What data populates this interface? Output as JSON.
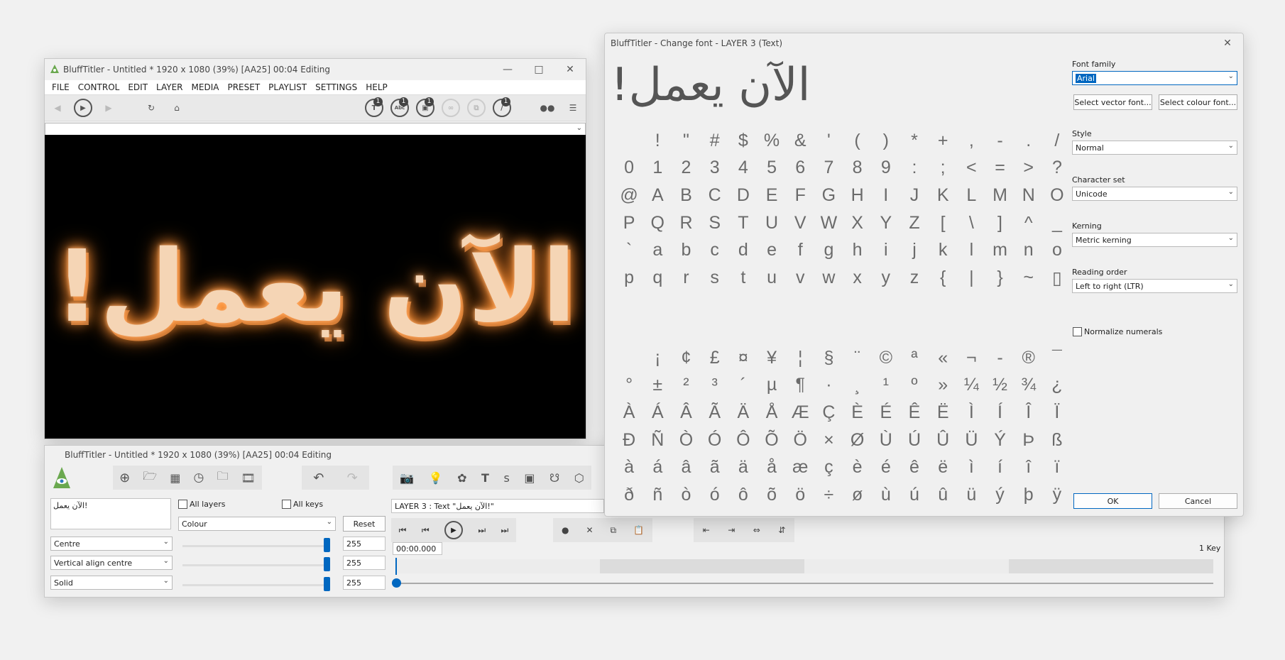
{
  "main_window": {
    "title": "BluffTitler - Untitled * 1920 x 1080 (39%) [AA25] 00:04 Editing",
    "menu": [
      "FILE",
      "CONTROL",
      "EDIT",
      "LAYER",
      "MEDIA",
      "PRESET",
      "PLAYLIST",
      "SETTINGS",
      "HELP"
    ],
    "badges": {
      "text": "1",
      "font": "1",
      "picture": "1",
      "effect": "1"
    },
    "preview_text": "الآن يعمل!"
  },
  "control_window": {
    "title": "BluffTitler - Untitled * 1920 x 1080 (39%) [AA25] 00:04 Editing",
    "text_content": "الآن يعمل!",
    "all_layers_label": "All layers",
    "all_keys_label": "All keys",
    "property_select": "Colour",
    "reset_label": "Reset",
    "layer_label": "LAYER 3  : Text \"الآن يعمل!\"",
    "align_select": "Centre",
    "valign_select": "Vertical align centre",
    "fill_select": "Solid",
    "values": [
      "255",
      "255",
      "255"
    ],
    "slider_levels": [
      1.0,
      1.0,
      1.0
    ],
    "time_field": "00:00.000",
    "keys_label": "1 Key"
  },
  "font_dialog": {
    "title": "BluffTitler - Change font - LAYER 3 (Text)",
    "sample": "الآن يعمل!",
    "font_family_label": "Font family",
    "font_family_value": "Arial",
    "select_vector_label": "Select vector font...",
    "select_colour_label": "Select colour font...",
    "style_label": "Style",
    "style_value": "Normal",
    "charset_label": "Character set",
    "charset_value": "Unicode",
    "kerning_label": "Kerning",
    "kerning_value": "Metric kerning",
    "reading_order_label": "Reading order",
    "reading_order_value": "Left to right (LTR)",
    "normalize_label": "Normalize numerals",
    "ok_label": "OK",
    "cancel_label": "Cancel",
    "glyph_rows": [
      " !\"#$%&'()*+,-./",
      "0123456789:;<=>?",
      "@ABCDEFGHIJKLMNO",
      "PQRSTUVWXYZ[\\]^_",
      "`abcdefghijklmno",
      "pqrstuvwxyz{|}~▯",
      " ¡¢£¤¥¦§¨©ª«¬-®¯",
      "°±²³´µ¶·¸¹º»¼½¾¿",
      "ÀÁÂÃÄÅÆÇÈÉÊËÌÍÎÏ",
      "ÐÑÒÓÔÕÖ×ØÙÚÛÜÝÞß",
      "àáâãäåæçèéêëìíîï",
      "ðñòóôõö÷øùúûüýþÿ"
    ]
  }
}
